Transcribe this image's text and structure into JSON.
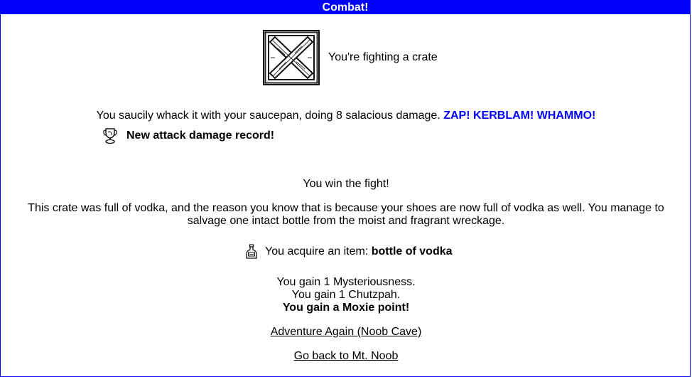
{
  "title": "Combat!",
  "monster": {
    "image_icon": "crate-icon",
    "text": "You're fighting a crate"
  },
  "attack": {
    "text": "You saucily whack it with your saucepan, doing 8 salacious damage.",
    "sound": "ZAP! KERBLAM! WHAMMO!"
  },
  "record": {
    "icon": "trophy-icon",
    "text": "New attack damage record!"
  },
  "result": {
    "win_text": "You win the fight!",
    "flavor_line1": "This crate was full of vodka, and the reason you know that is because your shoes are now full of vodka as well. You manage to",
    "flavor_line2": "salvage one intact bottle from the moist and fragrant wreckage."
  },
  "item": {
    "icon": "bottle-icon",
    "prefix": "You acquire an item: ",
    "name": "bottle of vodka"
  },
  "gains": {
    "line1": "You gain 1 Mysteriousness.",
    "line2": "You gain 1 Chutzpah.",
    "line3": "You gain a Moxie point!"
  },
  "links": {
    "adventure_again": "Adventure Again (Noob Cave)",
    "go_back": "Go back to Mt. Noob"
  },
  "colors": {
    "accent": "#0000ff"
  }
}
